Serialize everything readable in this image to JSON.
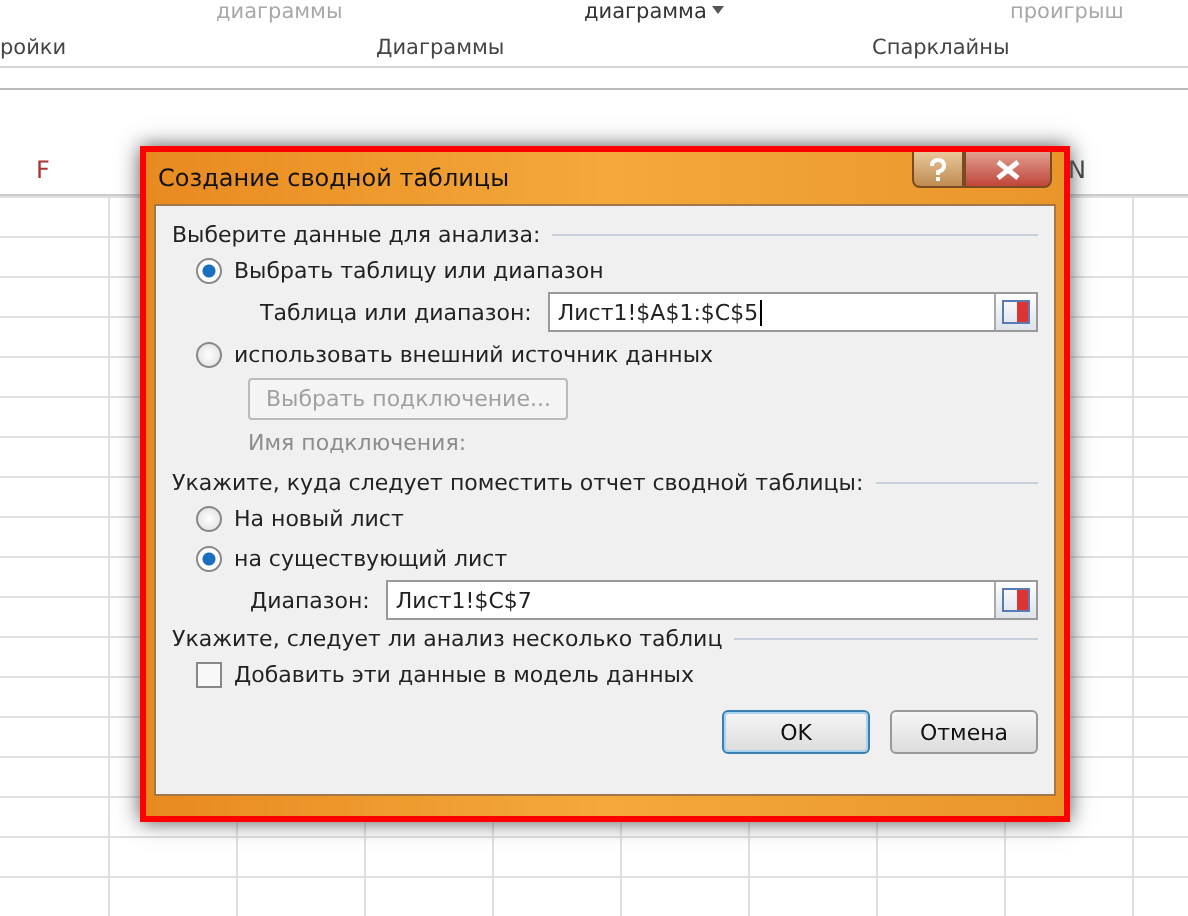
{
  "ribbon": {
    "top_labels": [
      {
        "text": "диаграммы",
        "disabled": true
      },
      {
        "text": "диаграмма",
        "disabled": false,
        "dropdown": true
      },
      {
        "text": "проигрыш",
        "disabled": true
      }
    ],
    "groups": [
      "ройки",
      "Диаграммы",
      "Спарклайны"
    ]
  },
  "sheet": {
    "columns": [
      "F",
      "N"
    ]
  },
  "dialog": {
    "title": "Создание сводной таблицы",
    "section1": "Выберите данные для анализа:",
    "source_options": [
      {
        "label": "Выбрать таблицу или диапазон",
        "selected": true
      },
      {
        "label": "использовать внешний источник данных",
        "selected": false
      }
    ],
    "table_range": {
      "label": "Таблица или диапазон:",
      "value": "Лист1!$A$1:$C$5"
    },
    "connection_button": {
      "label": "Выбрать подключение...",
      "disabled": true
    },
    "connection_name": {
      "label": "Имя подключения:",
      "disabled": true
    },
    "section2": "Укажите, куда следует поместить отчет сводной таблицы:",
    "dest_options": [
      {
        "label": "На новый лист",
        "selected": false
      },
      {
        "label": "на существующий лист",
        "selected": true
      }
    ],
    "dest_range": {
      "label": "Диапазон:",
      "value": "Лист1!$C$7"
    },
    "section3": "Укажите, следует ли анализ несколько таблиц",
    "data_model": {
      "label": "Добавить эти данные в модель данных",
      "checked": false
    },
    "buttons": [
      "OK",
      "Отмена"
    ]
  }
}
